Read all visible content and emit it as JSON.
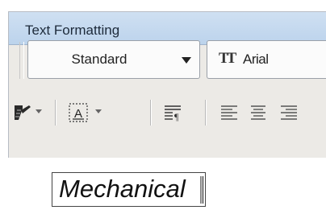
{
  "window": {
    "title": "Text Formatting"
  },
  "row1": {
    "style_value": "Standard",
    "font_value": "Arial",
    "style_arrow_icon": "chevron-down-icon",
    "font_type_icon": "truetype-icon"
  },
  "row2": {
    "icons": [
      "color-icon",
      "mtext-dropdown-icon",
      "paragraph-icon",
      "align-left-icon",
      "align-center-icon",
      "align-right-icon"
    ]
  },
  "editor": {
    "text": "Mechanical"
  }
}
